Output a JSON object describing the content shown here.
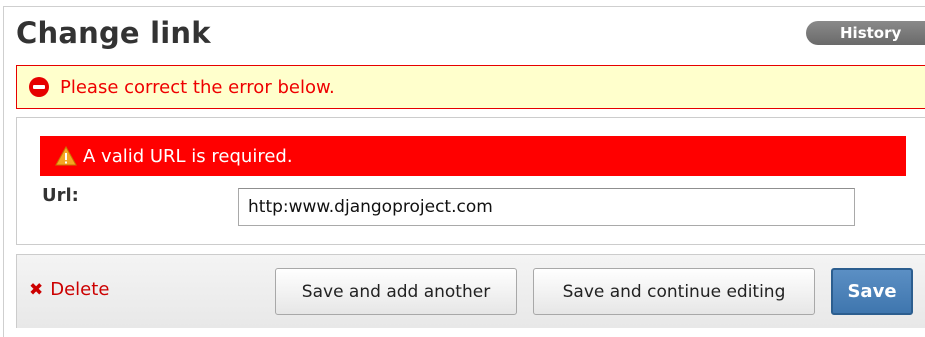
{
  "page": {
    "title": "Change link",
    "history_label": "History"
  },
  "error_note": {
    "message": "Please correct the error below."
  },
  "form": {
    "field_error": "A valid URL is required.",
    "url_label": "Url:",
    "url_value": "http:www.djangoproject.com"
  },
  "submit_row": {
    "delete_label": "Delete",
    "save_add_another": "Save and add another",
    "save_continue": "Save and continue editing",
    "save": "Save"
  },
  "colors": {
    "error_red": "#ff0000",
    "error_note_bg": "#ffffcc",
    "save_blue": "#417690"
  },
  "icons": {
    "error_note": "minus-circle-icon",
    "field_error": "warning-triangle-icon",
    "delete": "x-icon"
  }
}
